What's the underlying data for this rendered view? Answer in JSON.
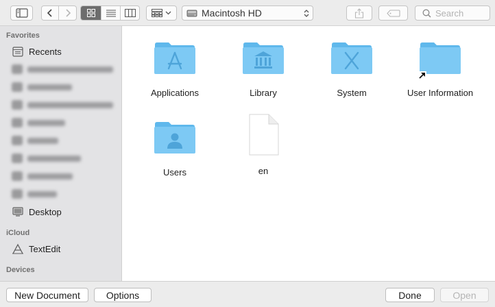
{
  "toolbar": {
    "location_label": "Macintosh HD",
    "search_placeholder": "Search"
  },
  "sidebar": {
    "favorites_header": "Favorites",
    "favorites": [
      {
        "label": "Recents",
        "icon": "recents-icon"
      },
      {
        "label": "Desktop",
        "icon": "desktop-icon"
      }
    ],
    "icloud_header": "iCloud",
    "icloud": [
      {
        "label": "TextEdit",
        "icon": "textedit-icon"
      }
    ],
    "devices_header": "Devices"
  },
  "main": {
    "items": [
      {
        "name": "Applications",
        "icon": "folder-applications-icon"
      },
      {
        "name": "Library",
        "icon": "folder-library-icon"
      },
      {
        "name": "System",
        "icon": "folder-system-icon"
      },
      {
        "name": "User Information",
        "icon": "folder-alias-icon"
      },
      {
        "name": "Users",
        "icon": "folder-users-icon"
      },
      {
        "name": "en",
        "icon": "document-icon"
      }
    ]
  },
  "bottom": {
    "new_document": "New Document",
    "options": "Options",
    "done": "Done",
    "open": "Open"
  },
  "colors": {
    "folder": "#7dc9f4",
    "folder_tab": "#5fb8ec",
    "active_view": "#6d6d6d"
  }
}
